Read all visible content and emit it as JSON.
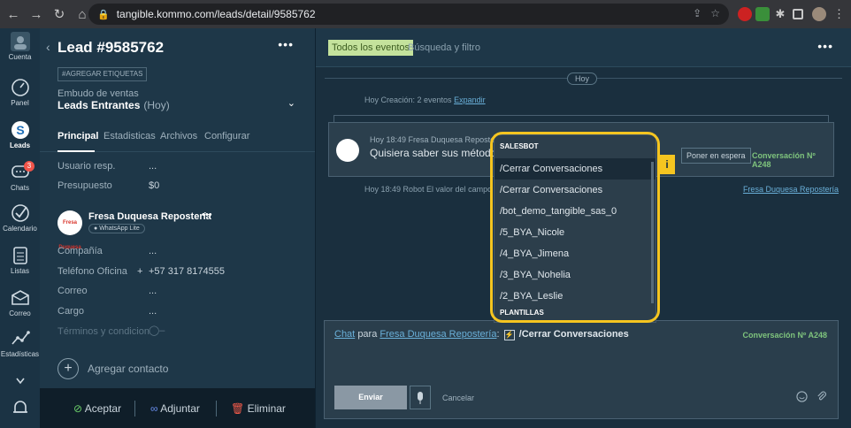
{
  "browser": {
    "url": "tangible.kommo.com/leads/detail/9585762"
  },
  "nav": {
    "items": [
      {
        "label": "Cuenta"
      },
      {
        "label": "Panel"
      },
      {
        "label": "Leads"
      },
      {
        "label": "Chats",
        "badge": "3"
      },
      {
        "label": "Calendario"
      },
      {
        "label": "Listas"
      },
      {
        "label": "Correo"
      },
      {
        "label": "Estadísticas"
      }
    ]
  },
  "lead": {
    "title": "Lead #9585762",
    "tag_button": "#AGREGAR ETIQUETAS",
    "funnel_label": "Embudo de ventas",
    "funnel_value": "Leads Entrantes",
    "funnel_time": "(Hoy)",
    "tabs": [
      "Principal",
      "Estadisticas",
      "Archivos",
      "Configurar"
    ],
    "fields": [
      {
        "label": "Usuario resp.",
        "value": "..."
      },
      {
        "label": "Presupuesto",
        "value": "$0"
      }
    ],
    "contact": {
      "avatar_text": "Fresa Duquesa",
      "name": "Fresa Duquesa Repostería",
      "channel": "WhatsApp Lite",
      "fields": [
        {
          "label": "Compañía",
          "value": "..."
        },
        {
          "label": "Teléfono Oficina",
          "value": "+57 317 8174555"
        },
        {
          "label": "Correo",
          "value": "..."
        },
        {
          "label": "Cargo",
          "value": "..."
        },
        {
          "label": "Términos y condicion",
          "value": ""
        }
      ]
    },
    "add_contact": "Agregar contacto",
    "actions": {
      "accept": "Aceptar",
      "attach": "Adjuntar",
      "delete": "Eliminar"
    }
  },
  "feed": {
    "filter_all": "Todos los eventos",
    "filter_search": "Búsqueda y filtro",
    "day": "Hoy",
    "creation_line": "Hoy Creación: 2 eventos",
    "expand": "Expandir",
    "message": {
      "meta": "Hoy 18:49 Fresa Duquesa Repostería",
      "text": "Quisiera saber sus métodos de",
      "hold_button": "Poner en espera",
      "conversation": "Conversación Nº A248"
    },
    "robot_line": "Hoy 18:49 Robot El valor del campo",
    "robot_link": "Fresa Duquesa Repostería"
  },
  "composer": {
    "chat_link": "Chat",
    "para": "para",
    "recipient": "Fresa Duquesa Repostería",
    "bolt": "⚡",
    "command": "/Cerrar Conversaciones",
    "conversation": "Conversación Nº A248",
    "send": "Enviar",
    "cancel": "Cancelar"
  },
  "dropdown": {
    "header": "SALESBOT",
    "items": [
      "/Cerrar Conversaciones",
      "/Cerrar Conversaciones",
      "/bot_demo_tangible_sas_0",
      "/5_BYA_Nicole",
      "/4_BYA_Jimena",
      "/3_BYA_Nohelia",
      "/2_BYA_Leslie"
    ],
    "footer": "PLANTILLAS",
    "info_tag": "i"
  },
  "colors": {
    "highlight": "#f5c520",
    "conversation_green": "#7fc47d",
    "link": "#6ab0d9"
  }
}
